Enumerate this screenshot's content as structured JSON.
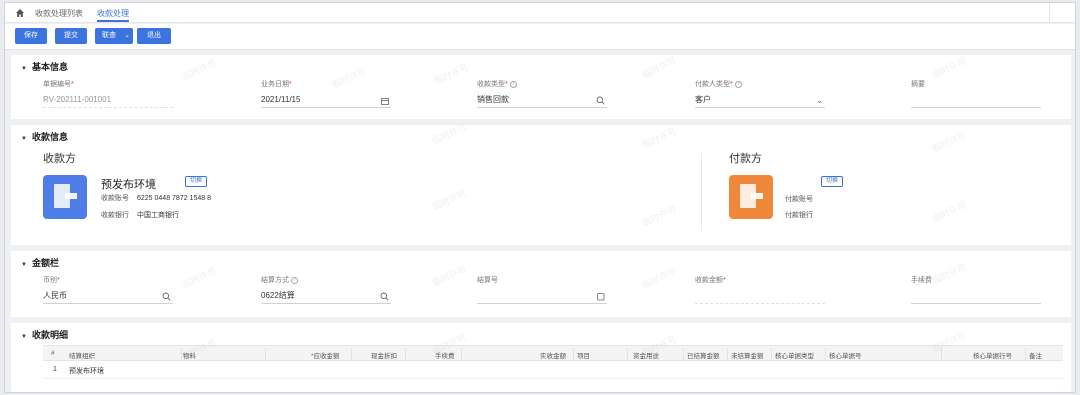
{
  "breadcrumb": {
    "list_label": "收款处理列表",
    "current_label": "收款处理"
  },
  "toolbar": {
    "save": "保存",
    "submit": "提交",
    "linked": "联查",
    "exit": "退出"
  },
  "basic_info": {
    "title": "基本信息",
    "doc_no": {
      "label": "单据编号",
      "value": "RV-202111-001001"
    },
    "biz_date": {
      "label": "业务日期",
      "value": "2021/11/15"
    },
    "receipt_type": {
      "label": "收款类型",
      "value": "销售回款"
    },
    "payer_type": {
      "label": "付款人类型",
      "value": "客户"
    },
    "summary": {
      "label": "摘要",
      "value": ""
    }
  },
  "collection_info": {
    "title": "收款信息",
    "receiver": {
      "heading": "收款方",
      "name": "预发布环境",
      "switch_label": "切换",
      "account_label": "收款账号",
      "account_value": "6225 0448 7872 1548 8",
      "bank_label": "收款银行",
      "bank_value": "中国工商银行"
    },
    "payer": {
      "heading": "付款方",
      "switch_label": "切换",
      "account_label": "付款账号",
      "bank_label": "付款银行"
    }
  },
  "amount": {
    "title": "金额栏",
    "currency": {
      "label": "币别",
      "value": "人民币"
    },
    "settle_method": {
      "label": "结算方式",
      "value": "0622结算"
    },
    "settle_no": {
      "label": "结算号",
      "value": ""
    },
    "receipt_amount": {
      "label": "收款金额",
      "value": ""
    },
    "fee": {
      "label": "手续费",
      "value": ""
    }
  },
  "detail": {
    "title": "收款明细",
    "columns": [
      "#",
      "结算组织",
      "物料",
      "应收金额",
      "现金折扣",
      "手续费",
      "实收金额",
      "项目",
      "资金用途",
      "已结算金额",
      "未结算金额",
      "核心单据类型",
      "核心单据号",
      "核心单据行号",
      "备注"
    ],
    "rows": [
      {
        "index": "1",
        "org": "预发布环境"
      }
    ]
  },
  "watermark_text": "临时许可",
  "colors": {
    "primary": "#3b73e0",
    "required": "#e0393e",
    "receiver_icon": "#4e7de8",
    "payer_icon": "#f0883a"
  },
  "icons": [
    "home-icon",
    "calendar-icon",
    "search-icon",
    "chevron-down-icon",
    "copy-icon"
  ]
}
